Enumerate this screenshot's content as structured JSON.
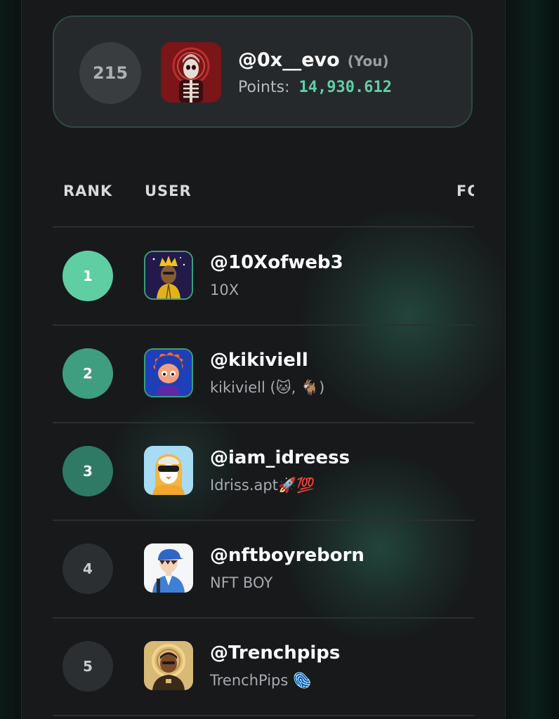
{
  "current_user": {
    "rank": "215",
    "handle": "@0x__evo",
    "you_tag": "(You)",
    "points_label": "Points:",
    "points_value": "14,930.612"
  },
  "table": {
    "headers": {
      "rank": "RANK",
      "user": "USER",
      "third": "FO"
    },
    "rows": [
      {
        "rank": "1",
        "handle": "@10Xofweb3",
        "display_name": "10X",
        "badge_color": "#5fcea2",
        "avatar_icon": "crowned-king-avatar-icon"
      },
      {
        "rank": "2",
        "handle": "@kikiviell",
        "display_name": "kikiviell (🐱, 🐐)",
        "badge_color": "#3f9e7f",
        "avatar_icon": "orange-haired-character-avatar-icon"
      },
      {
        "rank": "3",
        "handle": "@iam_idreess",
        "display_name": "Idriss.apt🚀💯",
        "badge_color": "#2f7a64",
        "avatar_icon": "penguin-with-sunglasses-avatar-icon"
      },
      {
        "rank": "4",
        "handle": "@nftboyreborn",
        "display_name": "NFT BOY",
        "badge_color": "#2c2f32",
        "avatar_icon": "anime-boy-cap-avatar-icon"
      },
      {
        "rank": "5",
        "handle": "@Trenchpips",
        "display_name": "TrenchPips 🫆",
        "badge_color": "#2c2f32",
        "avatar_icon": "gold-halo-man-avatar-icon"
      }
    ]
  },
  "colors": {
    "accent_green": "#5fd0a6",
    "panel_bg": "#17191b",
    "card_border": "#2d4a43"
  }
}
